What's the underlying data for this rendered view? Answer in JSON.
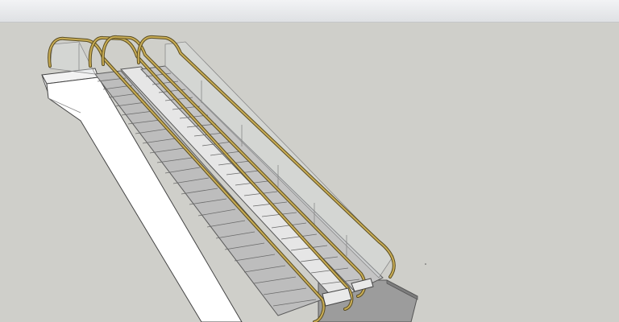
{
  "app": {
    "toolbar": {
      "visible": true
    },
    "viewport": {
      "background_color": "#cfcfca"
    }
  },
  "model": {
    "description_icon": "escalator-3d-model",
    "handrail_color": "#b39a4a",
    "handrail_edge_color": "#5a4d22",
    "step_color": "#bdbdbd",
    "step_edge_color": "#6b6b6b",
    "truss_color": "#ffffff",
    "landing_color": "#9c9c9c"
  }
}
